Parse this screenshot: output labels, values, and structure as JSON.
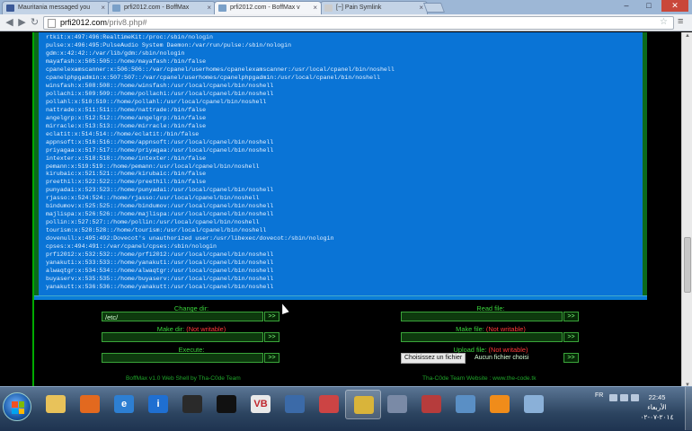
{
  "browser": {
    "tabs": [
      {
        "label": "Mauritania messaged you",
        "icon_color": "#3b5998",
        "active": false
      },
      {
        "label": "prfi2012.com - BoffMax",
        "icon_color": "#7aa0c8",
        "active": false
      },
      {
        "label": "prfi2012.com - BoffMax v",
        "icon_color": "#7aa0c8",
        "active": true
      },
      {
        "label": "[~] Pain Symlink",
        "icon_color": "#cccccc",
        "active": false
      }
    ],
    "url": {
      "host": "prfi2012.com",
      "path": "/priv8.php#"
    }
  },
  "passwd_lines": [
    "rtkit:x:497:496:RealtimeKit:/proc:/sbin/nologin",
    "pulse:x:496:495:PulseAudio System Daemon:/var/run/pulse:/sbin/nologin",
    "gdm:x:42:42::/var/lib/gdm:/sbin/nologin",
    "mayafash:x:505:505::/home/mayafash:/bin/false",
    "cpanelexamscanner:x:506:506::/var/cpanel/userhomes/cpanelexamscanner:/usr/local/cpanel/bin/noshell",
    "cpanelphpgadmin:x:507:507::/var/cpanel/userhomes/cpanelphpgadmin:/usr/local/cpanel/bin/noshell",
    "winsfash:x:508:508::/home/winsfash:/usr/local/cpanel/bin/noshell",
    "pollachi:x:509:509::/home/pollachi:/usr/local/cpanel/bin/noshell",
    "pollahl:x:510:510::/home/pollahl:/usr/local/cpanel/bin/noshell",
    "nattrade:x:511:511::/home/nattrade:/bin/false",
    "angelgrp:x:512:512::/home/angelgrp:/bin/false",
    "mirracle:x:513:513::/home/mirracle:/bin/false",
    "eclatit:x:514:514::/home/eclatit:/bin/false",
    "appnsoft:x:516:516::/home/appnsoft:/usr/local/cpanel/bin/noshell",
    "priyagaa:x:517:517::/home/priyagaa:/usr/local/cpanel/bin/noshell",
    "intexter:x:518:518::/home/intexter:/bin/false",
    "pemann:x:519:519::/home/pemann:/usr/local/cpanel/bin/noshell",
    "kirubaic:x:521:521::/home/kirubaic:/bin/false",
    "preethil:x:522:522::/home/preethil:/bin/false",
    "punyadai:x:523:523::/home/punyadai:/usr/local/cpanel/bin/noshell",
    "rjasso:x:524:524::/home/rjasso:/usr/local/cpanel/bin/noshell",
    "bindumov:x:525:525::/home/bindumov:/usr/local/cpanel/bin/noshell",
    "majlispa:x:526:526::/home/majlispa:/usr/local/cpanel/bin/noshell",
    "pollin:x:527:527::/home/pollin:/usr/local/cpanel/bin/noshell",
    "tourism:x:528:528::/home/tourism:/usr/local/cpanel/bin/noshell",
    "dovenull:x:495:492:Dovecot's unauthorized user:/usr/libexec/dovecot:/sbin/nologin",
    "cpses:x:494:491::/var/cpanel/cpses:/sbin/nologin",
    "prfi2012:x:532:532::/home/prfi2012:/usr/local/cpanel/bin/noshell",
    "yanakuti:x:533:533::/home/yanakuti:/usr/local/cpanel/bin/noshell",
    "alwaqtgr:x:534:534::/home/alwaqtgr:/usr/local/cpanel/bin/noshell",
    "buyaserv:x:535:535::/home/buyaserv:/usr/local/cpanel/bin/noshell",
    "yanakutt:x:536:536::/home/yanakutt:/usr/local/cpanel/bin/noshell"
  ],
  "panel": {
    "change_dir": {
      "label": "Change dir:",
      "value": "/etc/"
    },
    "read_file": {
      "label": "Read file:",
      "value": ""
    },
    "make_dir": {
      "label": "Make dir:",
      "warn": "(Not writable)"
    },
    "make_file": {
      "label": "Make file:",
      "warn": "(Not writable)"
    },
    "execute": {
      "label": "Execute:"
    },
    "upload_file": {
      "label": "Upload file:",
      "warn": "(Not writable)",
      "choose_label": "Choisissez un fichier",
      "no_file": "Aucun fichier choisi"
    },
    "go_label": ">>",
    "footer_left": "BoffMax v1.0 Web Shell by Tha-C0de Team",
    "footer_right": "Tha-C0de Team Website : www.the-code.tk"
  },
  "taskbar": {
    "apps": [
      {
        "name": "explorer-icon",
        "color": "#e8c25a",
        "glyph": ""
      },
      {
        "name": "firefox-icon",
        "color": "#e2691f",
        "glyph": ""
      },
      {
        "name": "ie-icon",
        "color": "#2d7fd2",
        "glyph": "e"
      },
      {
        "name": "info-icon",
        "color": "#1f6fd1",
        "glyph": "i"
      },
      {
        "name": "media-player-icon",
        "color": "#2a2a2a",
        "glyph": ""
      },
      {
        "name": "cmd-icon",
        "color": "#111111",
        "glyph": ""
      },
      {
        "name": "vb-icon",
        "color": "#e9e9e9",
        "glyph": "VB"
      },
      {
        "name": "network-icon",
        "color": "#3b6aa8",
        "glyph": ""
      },
      {
        "name": "flag-app-icon",
        "color": "#c44",
        "glyph": ""
      },
      {
        "name": "chrome-icon",
        "color": "#d9b43a",
        "glyph": ""
      },
      {
        "name": "computer-icon",
        "color": "#7a8aa6",
        "glyph": ""
      },
      {
        "name": "tool-icon",
        "color": "#b63c3c",
        "glyph": ""
      },
      {
        "name": "book-icon",
        "color": "#5a8fc5",
        "glyph": ""
      },
      {
        "name": "vlc-icon",
        "color": "#f08c1a",
        "glyph": ""
      },
      {
        "name": "window-icon",
        "color": "#8ab0d8",
        "glyph": ""
      }
    ],
    "lang": "FR",
    "time": "22:45",
    "day": "الأربعاء",
    "date": "٢٠١٤-٠٧-٠٢"
  }
}
